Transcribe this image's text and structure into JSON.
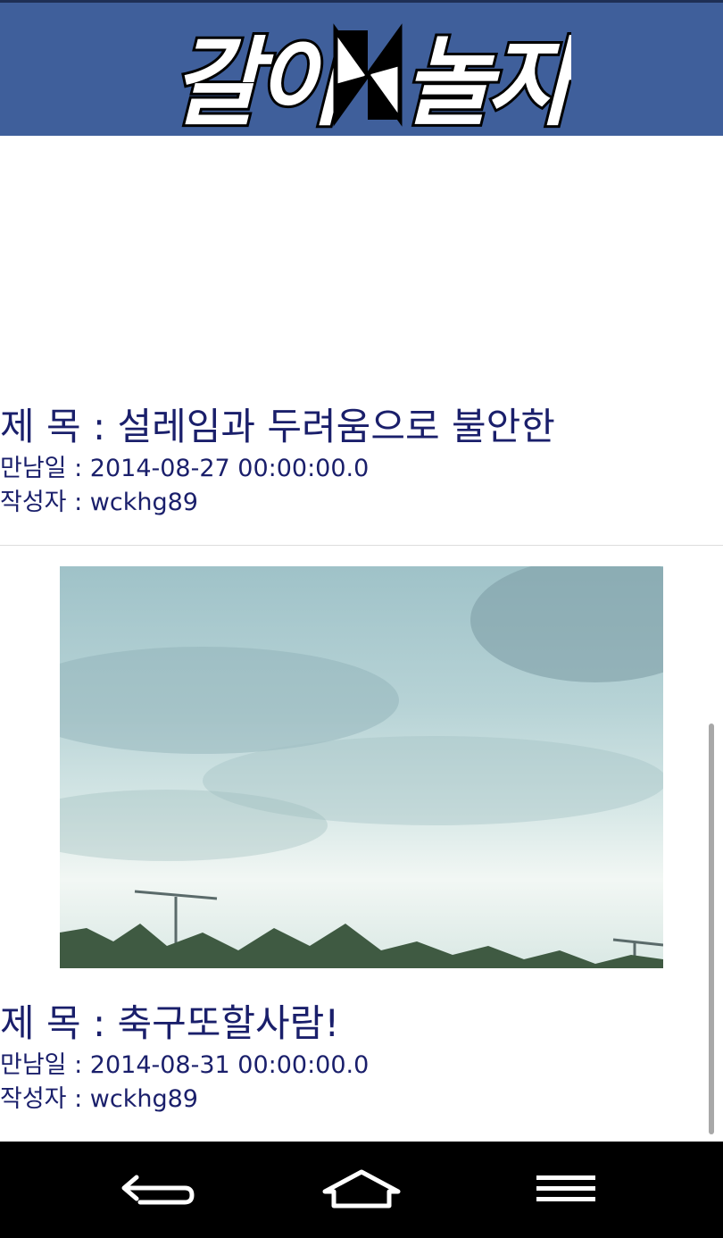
{
  "header": {
    "logo_text": "같이놀자",
    "background": "#3f5f9b"
  },
  "posts": [
    {
      "title": "제  목 :  설레임과 두려움으로 불안한",
      "date": "만남일 :  2014-08-27 00:00:00.0",
      "author": "작성자 :  wckhg89"
    },
    {
      "title": "제  목 :  축구또할사람!",
      "date": "만남일 :  2014-08-31 00:00:00.0",
      "author": "작성자 :  wckhg89",
      "photo_icon": "sky-photo"
    }
  ],
  "navbar": {
    "back_icon": "back-icon",
    "home_icon": "home-icon",
    "menu_icon": "menu-icon"
  },
  "colors": {
    "text": "#1a1f6b",
    "header": "#3f5f9b"
  }
}
